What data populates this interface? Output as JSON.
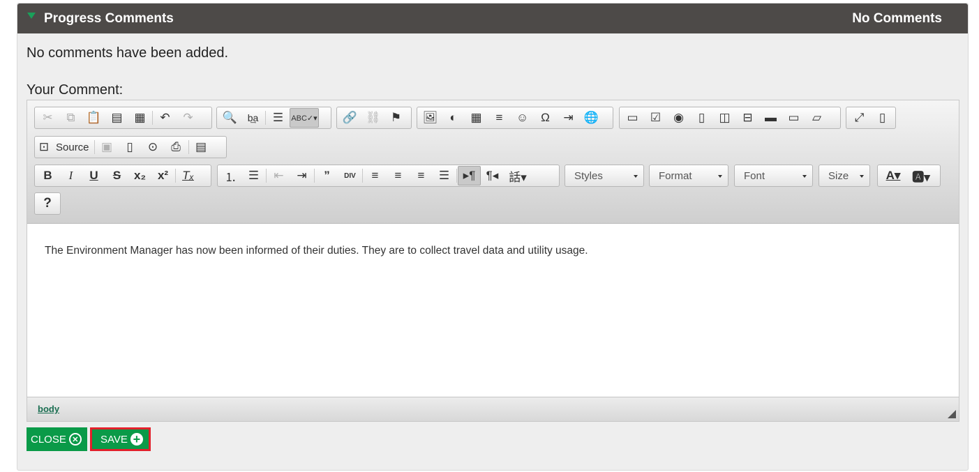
{
  "panel": {
    "title": "Progress Comments",
    "count_label": "No Comments",
    "empty_text": "No comments have been added.",
    "comment_label": "Your Comment:"
  },
  "editor": {
    "source_label": "Source",
    "combos": {
      "styles": "Styles",
      "format": "Format",
      "font": "Font",
      "size": "Size"
    },
    "content_text": "The Environment Manager has now been informed of their duties. They are to collect travel data and utility usage.",
    "element_path": "body"
  },
  "actions": {
    "close_label": "CLOSE",
    "save_label": "SAVE"
  },
  "colors": {
    "header_bg": "#4d4a48",
    "accent_green": "#0a9a48",
    "highlight_red": "#e2202b"
  }
}
